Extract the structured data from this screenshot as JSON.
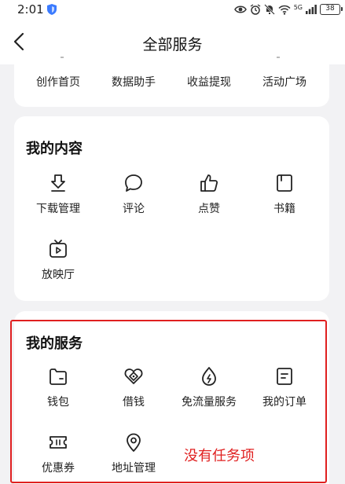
{
  "status_bar": {
    "time": "2:01",
    "network": "5G",
    "battery": "38"
  },
  "header": {
    "title": "全部服务"
  },
  "top_row": {
    "items": [
      {
        "label": "创作首页"
      },
      {
        "label": "数据助手"
      },
      {
        "label": "收益提现"
      },
      {
        "label": "活动广场"
      }
    ]
  },
  "my_content": {
    "title": "我的内容",
    "items": [
      {
        "label": "下载管理",
        "icon": "download-icon"
      },
      {
        "label": "评论",
        "icon": "comment-icon"
      },
      {
        "label": "点赞",
        "icon": "thumbs-up-icon"
      },
      {
        "label": "书籍",
        "icon": "book-icon"
      },
      {
        "label": "放映厅",
        "icon": "tv-icon"
      }
    ]
  },
  "my_services": {
    "title": "我的服务",
    "items": [
      {
        "label": "钱包",
        "icon": "wallet-icon"
      },
      {
        "label": "借钱",
        "icon": "borrow-icon"
      },
      {
        "label": "免流量服务",
        "icon": "free-data-icon"
      },
      {
        "label": "我的订单",
        "icon": "order-icon"
      },
      {
        "label": "优惠券",
        "icon": "coupon-icon"
      },
      {
        "label": "地址管理",
        "icon": "location-icon"
      }
    ]
  },
  "annotation": {
    "text": "没有任务项",
    "color": "#e02020"
  }
}
